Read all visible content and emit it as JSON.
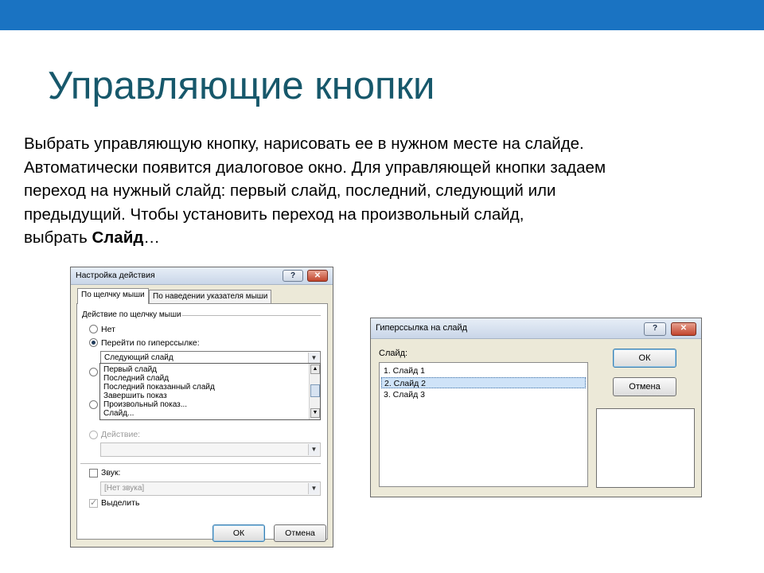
{
  "slide": {
    "title": "Управляющие кнопки",
    "body_lines": [
      "Выбрать управляющую кнопку, нарисовать ее в нужном месте на слайде.",
      "Автоматически появится диалоговое окно. Для управляющей кнопки задаем",
      "переход на нужный слайд: первый слайд, последний, следующий или",
      "предыдущий. Чтобы установить переход на произвольный слайд,"
    ],
    "body_last_prefix": "выбрать ",
    "body_last_bold": "Слайд",
    "body_last_suffix": "…"
  },
  "action_dialog": {
    "title": "Настройка действия",
    "help_label": "?",
    "close_label": "✕",
    "tabs": [
      {
        "label": "По щелчку мыши",
        "active": true
      },
      {
        "label": "По наведении указателя мыши",
        "active": false
      }
    ],
    "group_label": "Действие по щелчку мыши",
    "radio_none": "Нет",
    "radio_hyperlink": "Перейти по гиперссылке:",
    "hyperlink_value": "Следующий слайд",
    "dropdown_items": [
      "Первый слайд",
      "Последний слайд",
      "Последний показанный слайд",
      "Завершить показ",
      "Произвольный показ...",
      "Слайд..."
    ],
    "radio_action": "Действие:",
    "action_value": "",
    "sound_label": "Звук:",
    "sound_value": "[Нет звука]",
    "highlight_label": "Выделить",
    "ok_label": "ОК",
    "cancel_label": "Отмена",
    "arrow_glyph": "▼",
    "scroll_up": "▲",
    "scroll_down": "▼"
  },
  "link_dialog": {
    "title": "Гиперссылка на слайд",
    "help_label": "?",
    "close_label": "✕",
    "list_label": "Слайд:",
    "slides": [
      "1. Слайд 1",
      "2. Слайд 2",
      "3. Слайд 3"
    ],
    "selected_index": 1,
    "ok_label": "ОК",
    "cancel_label": "Отмена"
  },
  "colors": {
    "top_bar": "#1a73c2",
    "title": "#17586b"
  }
}
